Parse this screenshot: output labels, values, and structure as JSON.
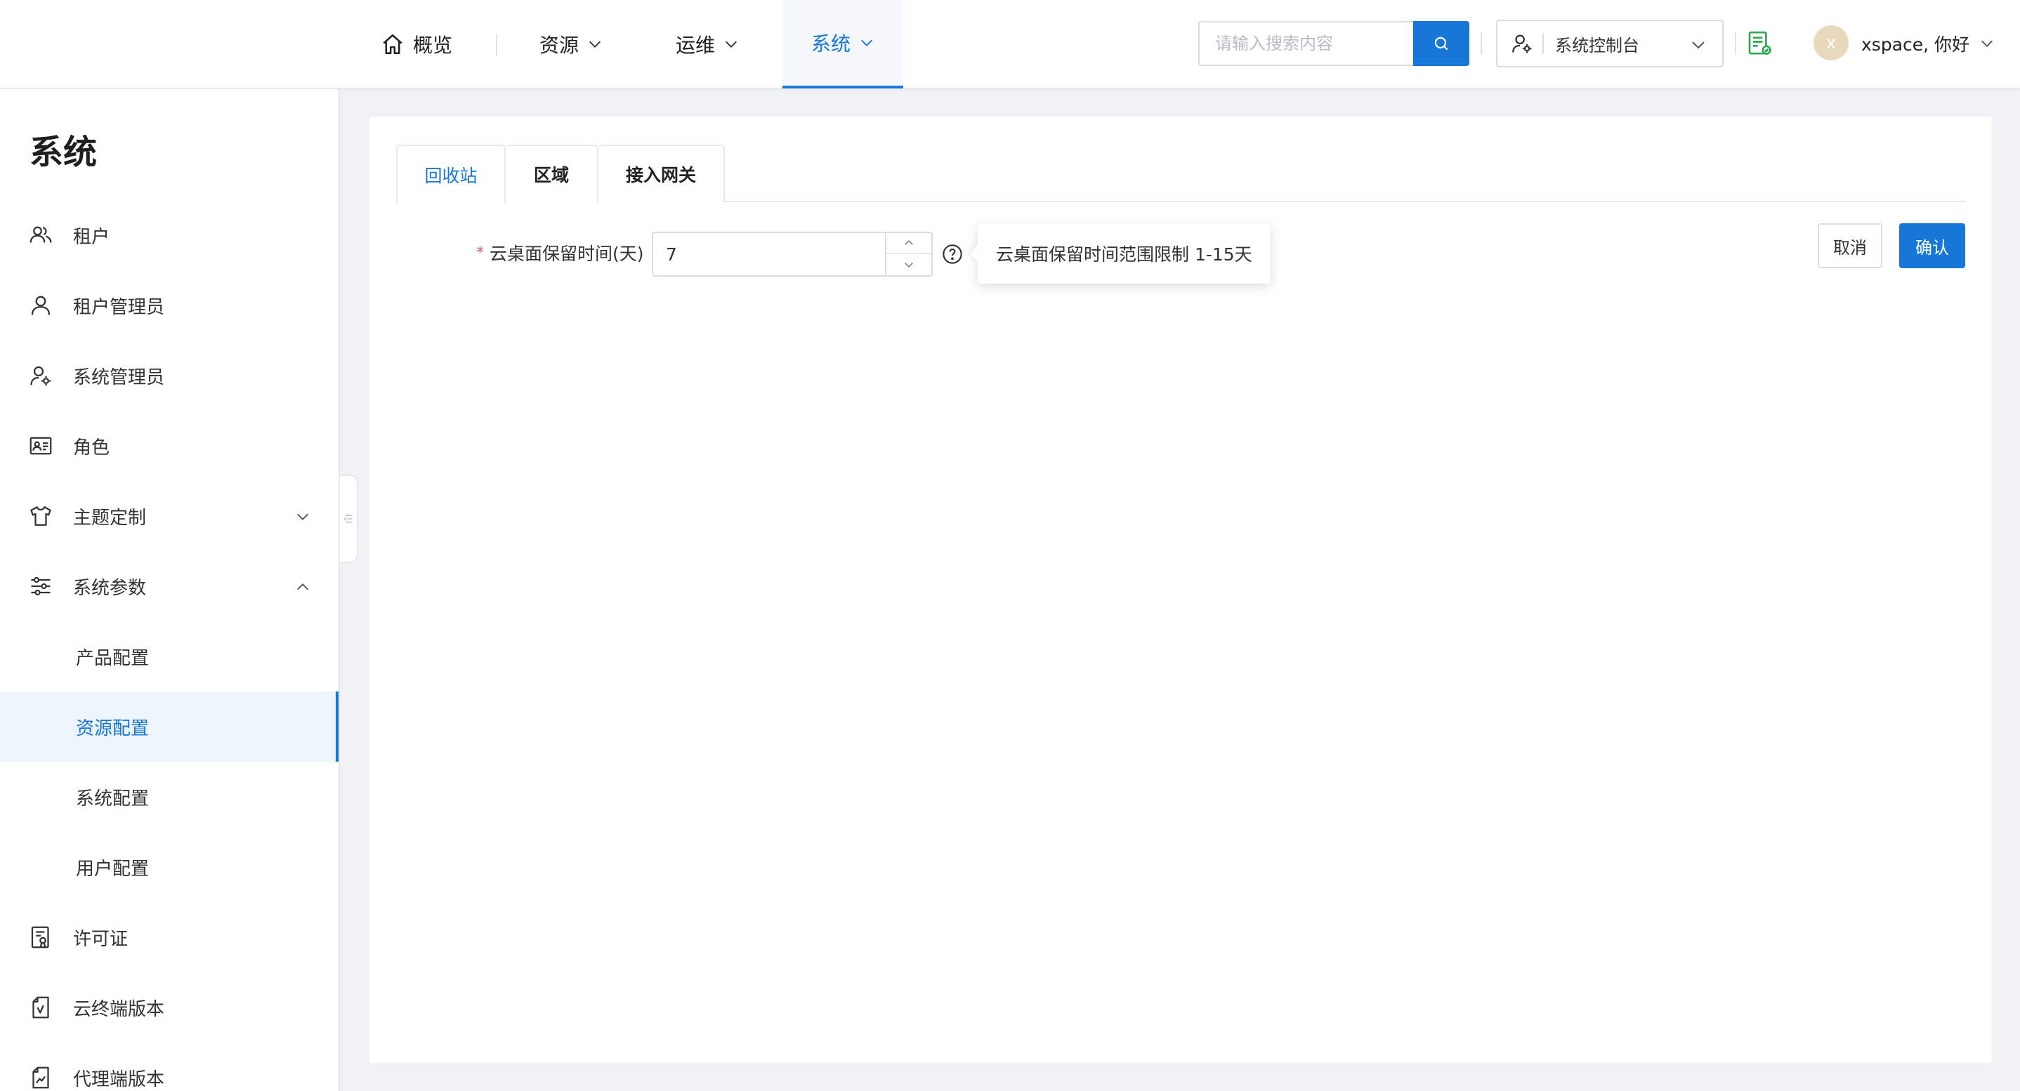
{
  "header": {
    "nav": [
      {
        "label": "概览",
        "icon": "home-icon",
        "active": false
      },
      {
        "label": "资源",
        "icon": "chevron-down-icon",
        "active": false
      },
      {
        "label": "运维",
        "icon": "chevron-down-icon",
        "active": false
      },
      {
        "label": "系统",
        "icon": "chevron-down-icon",
        "active": true
      }
    ],
    "search": {
      "placeholder": "请输入搜索内容",
      "value": ""
    },
    "console": {
      "label": "系统控制台"
    },
    "user": {
      "avatar_letter": "x",
      "greeting": "xspace, 你好"
    }
  },
  "sidebar": {
    "title": "系统",
    "items": [
      {
        "label": "租户",
        "icon": "users-icon"
      },
      {
        "label": "租户管理员",
        "icon": "user-icon"
      },
      {
        "label": "系统管理员",
        "icon": "user-settings-icon"
      },
      {
        "label": "角色",
        "icon": "id-card-icon"
      },
      {
        "label": "主题定制",
        "icon": "tshirt-icon",
        "expanded": false
      },
      {
        "label": "系统参数",
        "icon": "sliders-icon",
        "expanded": true
      },
      {
        "label": "许可证",
        "icon": "license-doc-icon"
      },
      {
        "label": "云终端版本",
        "icon": "terminal-version-icon"
      },
      {
        "label": "代理端版本",
        "icon": "agent-version-icon"
      }
    ],
    "sub_items": [
      {
        "label": "产品配置",
        "active": false
      },
      {
        "label": "资源配置",
        "active": true
      },
      {
        "label": "系统配置",
        "active": false
      },
      {
        "label": "用户配置",
        "active": false
      }
    ]
  },
  "main": {
    "tabs": [
      {
        "label": "回收站",
        "active": true
      },
      {
        "label": "区域",
        "active": false
      },
      {
        "label": "接入网关",
        "active": false
      }
    ],
    "form": {
      "required_mark": "*",
      "retention_label": "云桌面保留时间(天)",
      "retention_value": "7",
      "tooltip": "云桌面保留时间范围限制 1-15天"
    },
    "actions": {
      "cancel": "取消",
      "confirm": "确认"
    }
  },
  "colors": {
    "primary": "#1677d9",
    "required": "#e5484d",
    "license_green": "#2fa84f",
    "avatar": "#e8d9bd"
  }
}
